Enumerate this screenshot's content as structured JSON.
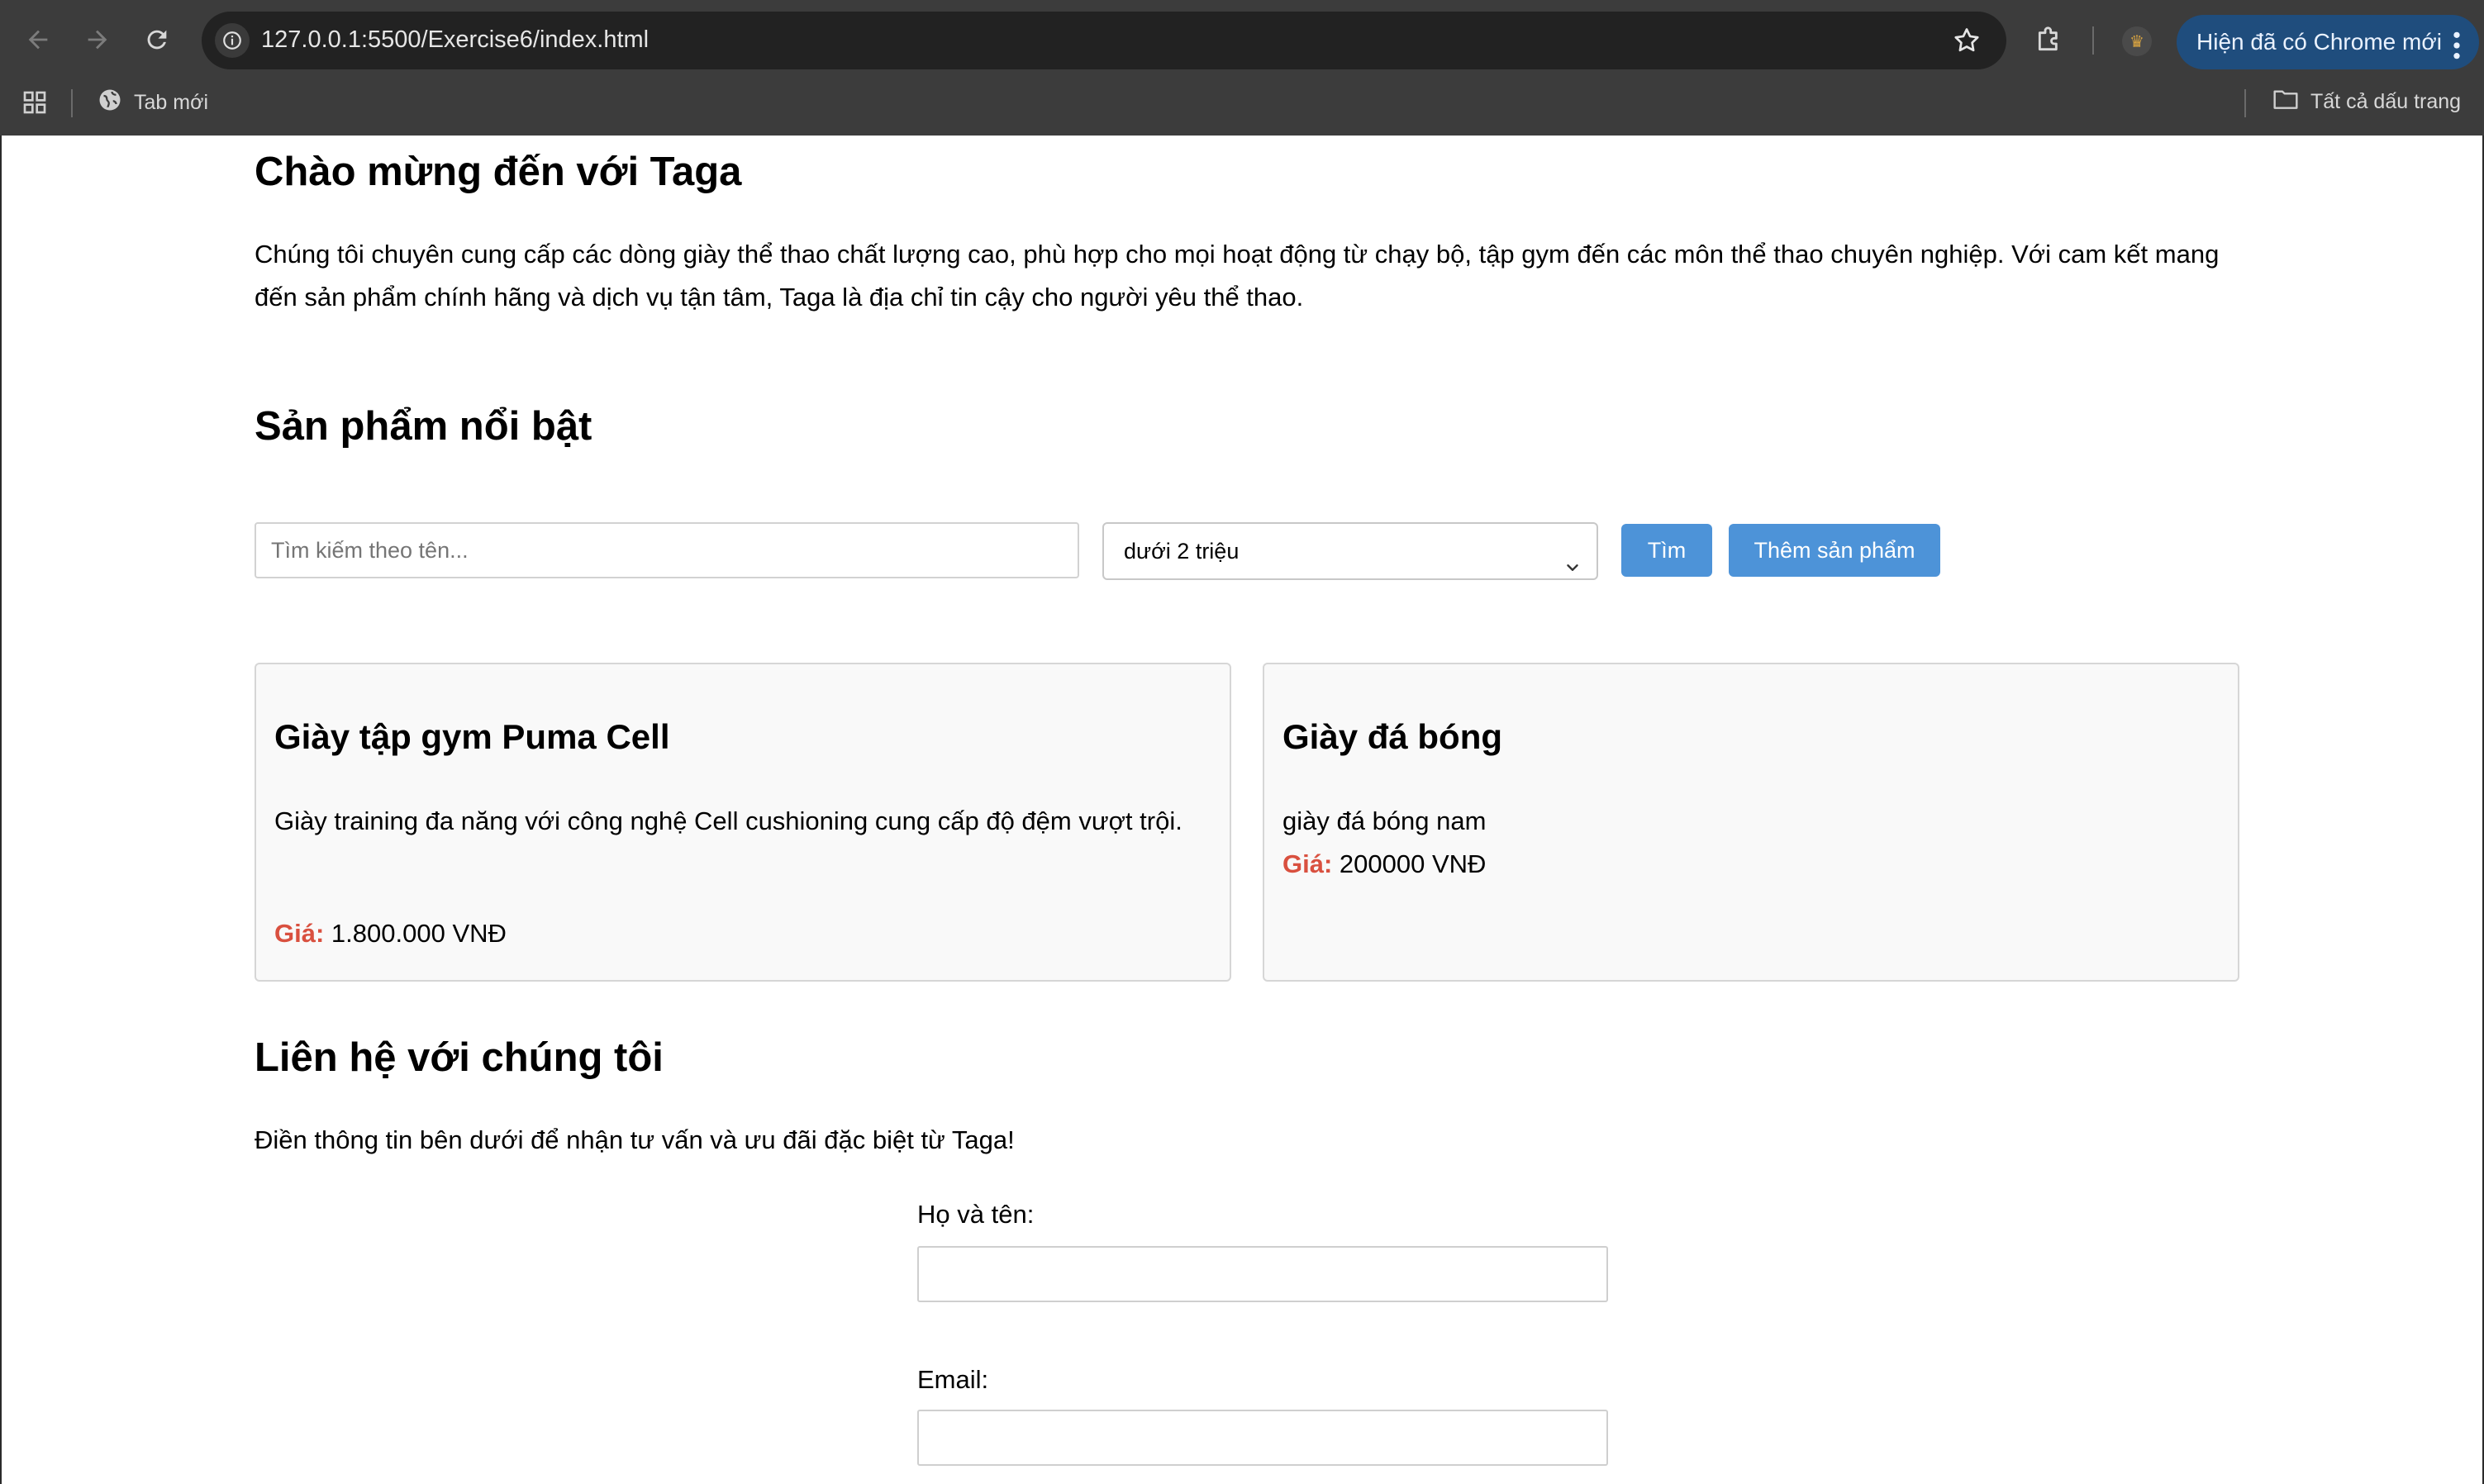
{
  "browser": {
    "url": "127.0.0.1:5500/Exercise6/index.html",
    "update_label": "Hiện đã có Chrome mới",
    "bookmarks": {
      "new_tab": "Tab mới",
      "all_bookmarks": "Tất cả dấu trang"
    }
  },
  "page": {
    "welcome_title": "Chào mừng đến với Taga",
    "intro": "Chúng tôi chuyên cung cấp các dòng giày thể thao chất lượng cao, phù hợp cho mọi hoạt động từ chạy bộ, tập gym đến các môn thể thao chuyên nghiệp. Với cam kết mang đến sản phẩm chính hãng và dịch vụ tận tâm, Taga là địa chỉ tin cậy cho người yêu thể thao.",
    "featured_title": "Sản phẩm nổi bật",
    "search": {
      "placeholder": "Tìm kiếm theo tên...",
      "price_filter_selected": "dưới 2 triệu",
      "search_button": "Tìm",
      "add_button": "Thêm sản phẩm"
    },
    "products": [
      {
        "name": "Giày tập gym Puma Cell",
        "description": "Giày training đa năng với công nghệ Cell cushioning cung cấp độ đệm vượt trội.",
        "price_label": "Giá:",
        "price": "1.800.000 VNĐ"
      },
      {
        "name": "Giày đá bóng",
        "description": "giày đá bóng nam",
        "price_label": "Giá:",
        "price": "200000 VNĐ"
      }
    ],
    "contact": {
      "title": "Liên hệ với chúng tôi",
      "text": "Điền thông tin bên dưới để nhận tư vấn và ưu đãi đặc biệt từ Taga!",
      "name_label": "Họ và tên:",
      "email_label": "Email:"
    }
  },
  "icons": {
    "back": "back-arrow-icon",
    "forward": "forward-arrow-icon",
    "reload": "reload-icon",
    "site_info": "site-info-icon",
    "bookmark_star": "star-icon",
    "extensions": "puzzle-icon",
    "menu": "kebab-menu-icon",
    "apps": "apps-grid-icon",
    "globe": "globe-icon",
    "folder": "folder-icon"
  },
  "colors": {
    "accent_button": "#4d93d8",
    "price_label": "#d9503f",
    "update_pill": "#1f4d7d"
  }
}
